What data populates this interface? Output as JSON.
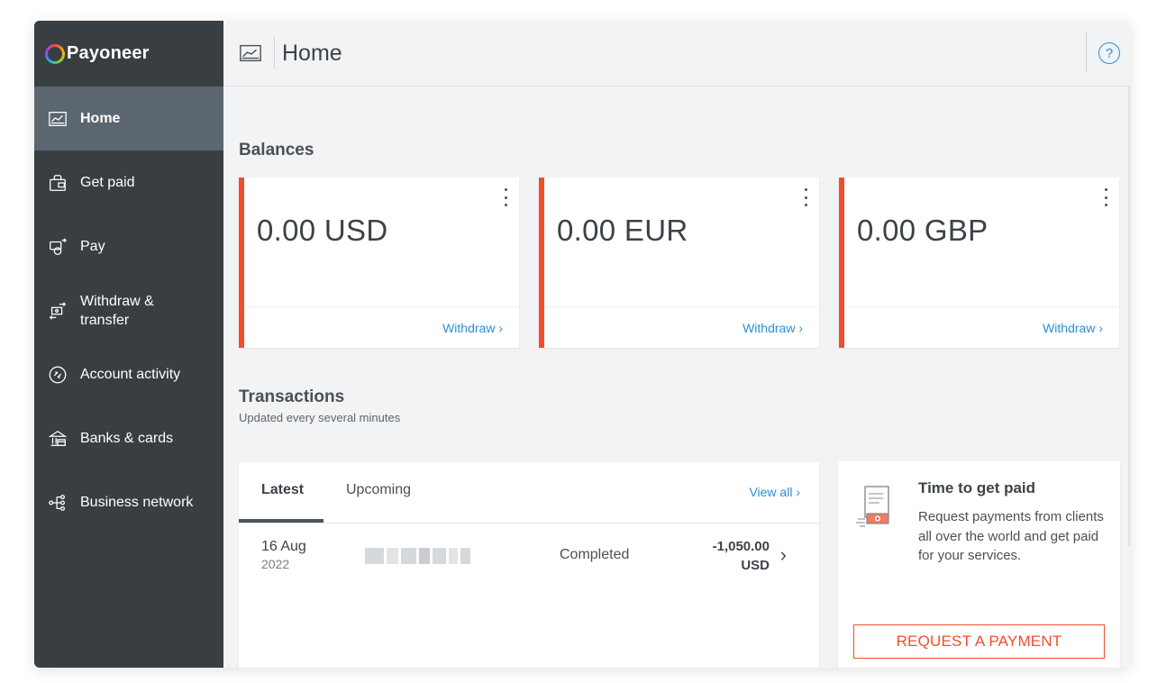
{
  "brand": {
    "name": "Payoneer"
  },
  "header": {
    "title": "Home",
    "icon": "chart-icon",
    "help_icon": "help-icon",
    "help_glyph": "?"
  },
  "sidebar": {
    "items": [
      {
        "label": "Home",
        "icon": "home-chart-icon",
        "active": true
      },
      {
        "label": "Get paid",
        "icon": "bag-icon",
        "active": false
      },
      {
        "label": "Pay",
        "icon": "pay-icon",
        "active": false
      },
      {
        "label": "Withdraw & transfer",
        "icon": "withdraw-icon",
        "active": false
      },
      {
        "label": "Account activity",
        "icon": "activity-icon",
        "active": false
      },
      {
        "label": "Banks & cards",
        "icon": "bank-icon",
        "active": false
      },
      {
        "label": "Business network",
        "icon": "network-icon",
        "active": false
      }
    ]
  },
  "balances": {
    "title": "Balances",
    "cards": [
      {
        "amount": "0.00 USD",
        "link": "Withdraw ›"
      },
      {
        "amount": "0.00 EUR",
        "link": "Withdraw ›"
      },
      {
        "amount": "0.00 GBP",
        "link": "Withdraw ›"
      }
    ]
  },
  "transactions": {
    "title": "Transactions",
    "subtitle": "Updated every several minutes",
    "tabs": [
      "Latest",
      "Upcoming"
    ],
    "view_all": "View all ›",
    "rows": [
      {
        "day": "16 Aug",
        "year": "2022",
        "status": "Completed",
        "amount": "-1,050.00",
        "currency": "USD"
      }
    ]
  },
  "promo": {
    "title": "Time to get paid",
    "text": "Request payments from clients all over the world and get paid for your services.",
    "button": "REQUEST A PAYMENT"
  },
  "colors": {
    "accent": "#f24e2d",
    "link": "#2a8fd6",
    "sidebar": "#393e43",
    "sidebar_active": "#5c6670"
  }
}
